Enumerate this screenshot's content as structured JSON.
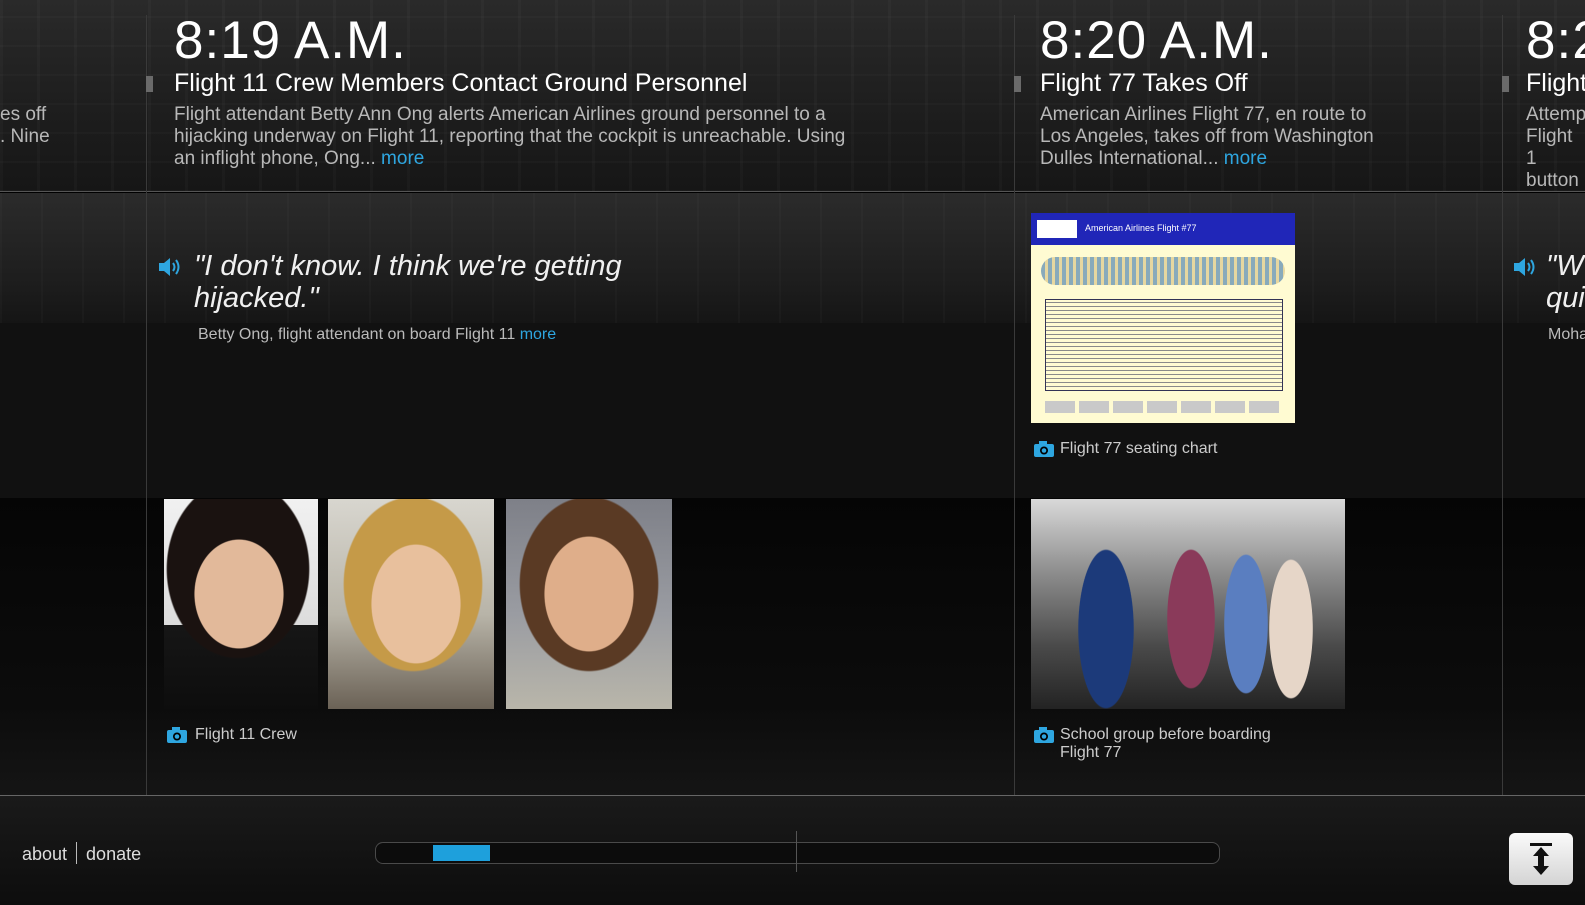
{
  "timeline": {
    "partial_left_lines": [
      "es off",
      ". Nine"
    ],
    "entries": [
      {
        "time": "8:19 A.M.",
        "headline": "Flight 11 Crew Members Contact Ground Personnel",
        "body_lines": [
          "Flight attendant Betty Ann Ong alerts American Airlines ground personnel to a",
          "hijacking underway on Flight 11, reporting that the cockpit is unreachable. Using",
          "an inflight phone, Ong..."
        ],
        "more": "more"
      },
      {
        "time": "8:20 A.M.",
        "headline": "Flight 77 Takes Off",
        "body_lines": [
          "American Airlines Flight 77, en route to",
          "Los Angeles, takes off from Washington",
          "Dulles International..."
        ],
        "more": "more"
      },
      {
        "time": "8:2",
        "headline": "Flight",
        "body_lines": [
          "Attemp",
          "Flight 1",
          "button"
        ]
      }
    ]
  },
  "quote_left": {
    "lines": [
      "\"I don't know. I think we're getting",
      "hijacked.\""
    ],
    "attribution": "Betty Ong, flight attendant on board Flight 11",
    "more": "more"
  },
  "quote_right": {
    "lines": [
      "\"W",
      "qui"
    ],
    "attribution": "Moha"
  },
  "media": {
    "seating_chart": {
      "caption": "Flight 77 seating chart",
      "chart_title": "American Airlines Flight #77"
    },
    "crew": {
      "caption": "Flight 11 Crew"
    },
    "school_group": {
      "caption_lines": [
        "School group before boarding",
        "Flight 77"
      ]
    }
  },
  "footer": {
    "about": "about",
    "donate": "donate",
    "scroll_position": 0.07
  },
  "colors": {
    "accent": "#2ea6e0",
    "thumb": "#1ea0dc",
    "background": "#000000"
  }
}
